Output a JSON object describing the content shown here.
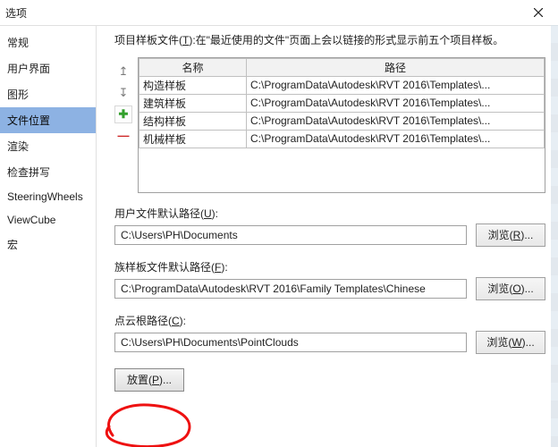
{
  "window": {
    "title": "选项"
  },
  "sidebar": {
    "items": [
      {
        "label": "常规"
      },
      {
        "label": "用户界面"
      },
      {
        "label": "图形"
      },
      {
        "label": "文件位置"
      },
      {
        "label": "渲染"
      },
      {
        "label": "检查拼写"
      },
      {
        "label": "SteeringWheels"
      },
      {
        "label": "ViewCube"
      },
      {
        "label": "宏"
      }
    ],
    "selectedIndex": 3
  },
  "main": {
    "description_prefix": "项目样板文件(",
    "description_hotkey": "T",
    "description_suffix": "):在\"最近使用的文件\"页面上会以链接的形式显示前五个项目样板。",
    "table": {
      "headers": {
        "name": "名称",
        "path": "路径"
      },
      "rows": [
        {
          "name": "构造样板",
          "path": "C:\\ProgramData\\Autodesk\\RVT 2016\\Templates\\..."
        },
        {
          "name": "建筑样板",
          "path": "C:\\ProgramData\\Autodesk\\RVT 2016\\Templates\\..."
        },
        {
          "name": "结构样板",
          "path": "C:\\ProgramData\\Autodesk\\RVT 2016\\Templates\\..."
        },
        {
          "name": "机械样板",
          "path": "C:\\ProgramData\\Autodesk\\RVT 2016\\Templates\\..."
        }
      ]
    },
    "tools": {
      "up": "↥",
      "down": "↧",
      "plus": "✚",
      "minus": "—"
    },
    "userFiles": {
      "label_prefix": "用户文件默认路径(",
      "label_hotkey": "U",
      "label_suffix": "):",
      "value": "C:\\Users\\PH\\Documents",
      "browse_prefix": "浏览(",
      "browse_hotkey": "R",
      "browse_suffix": ")..."
    },
    "familyTemplates": {
      "label_prefix": "族样板文件默认路径(",
      "label_hotkey": "F",
      "label_suffix": "):",
      "value": "C:\\ProgramData\\Autodesk\\RVT 2016\\Family Templates\\Chinese",
      "browse_prefix": "浏览(",
      "browse_hotkey": "O",
      "browse_suffix": ")..."
    },
    "pointCloud": {
      "label_prefix": "点云根路径(",
      "label_hotkey": "C",
      "label_suffix": "):",
      "value": "C:\\Users\\PH\\Documents\\PointClouds",
      "browse_prefix": "浏览(",
      "browse_hotkey": "W",
      "browse_suffix": ")..."
    },
    "places": {
      "label_prefix": "放置(",
      "label_hotkey": "P",
      "label_suffix": ")..."
    }
  }
}
